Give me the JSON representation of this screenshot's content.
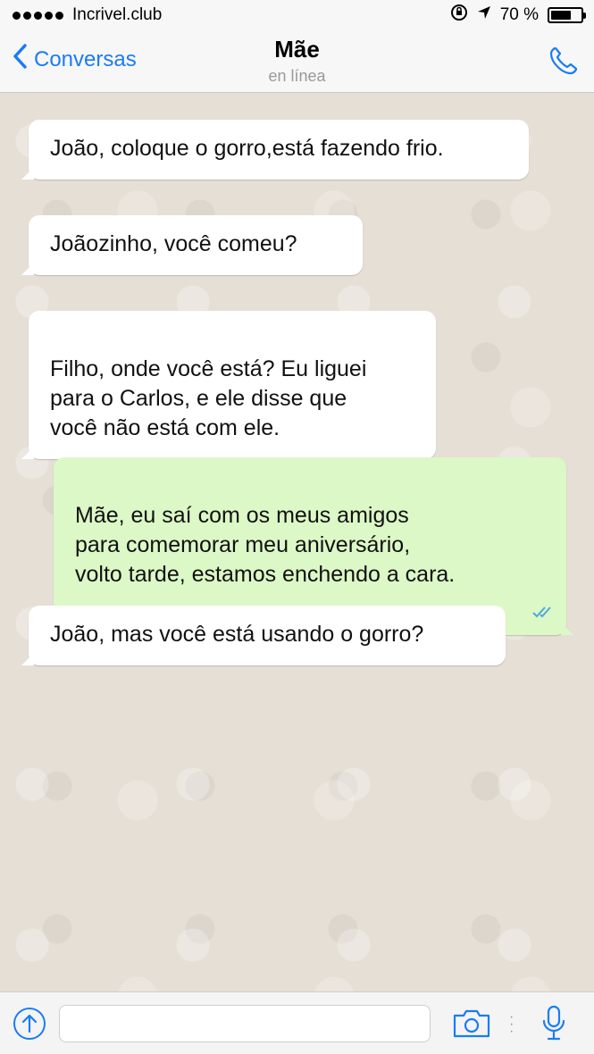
{
  "status_bar": {
    "carrier": "Incrivel.club",
    "battery": "70 %",
    "battery_level": 0.7
  },
  "header": {
    "back_label": "Conversas",
    "title": "Mãe",
    "subtitle": "en línea"
  },
  "messages": [
    {
      "direction": "in",
      "text": "João, coloque o gorro,está fazendo frio."
    },
    {
      "direction": "in",
      "text": "Joãozinho, você comeu?"
    },
    {
      "direction": "in",
      "text": "Filho, onde você está? Eu liguei\npara o Carlos, e ele disse que\nvocê não está com ele."
    },
    {
      "direction": "out",
      "text": "Mãe, eu saí com os meus amigos\npara comemorar meu aniversário,\nvolto tarde, estamos enchendo a cara.",
      "status": "read"
    },
    {
      "direction": "in",
      "text": "João, mas você está usando o gorro?"
    }
  ],
  "input": {
    "value": "",
    "placeholder": ""
  },
  "colors": {
    "accent": "#1a7cf5",
    "outgoing_bubble": "#dcf8c6",
    "incoming_bubble": "#ffffff",
    "read_ticks": "#4fa8e0"
  },
  "icons": [
    "signal-icon",
    "rotation-lock-icon",
    "location-arrow-icon",
    "battery-icon",
    "back-chevron-icon",
    "phone-icon",
    "share-icon",
    "camera-icon",
    "microphone-icon",
    "double-check-icon"
  ]
}
